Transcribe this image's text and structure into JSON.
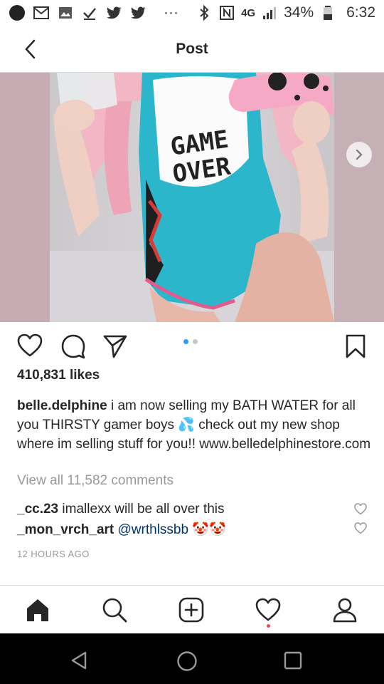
{
  "status_bar": {
    "battery": "34%",
    "time": "6:32",
    "network": "4G"
  },
  "header": {
    "title": "Post"
  },
  "post": {
    "image_alt": "Photo post, slide 1 of 2",
    "shirt_text": "GAME OVER",
    "carousel_count": 2,
    "carousel_active": 1
  },
  "likes": "410,831 likes",
  "caption": {
    "username": "belle.delphine",
    "text_before_emoji": "i am now selling my BATH WATER for all you THIRSTY gamer boys",
    "emoji": "💦",
    "text_after_emoji": "check out my new shop where im selling stuff for you!! www.belledelphinestore.com"
  },
  "view_comments": "View all 11,582 comments",
  "comments": [
    {
      "username": "_cc.23",
      "text": "imallexx will be all over this",
      "mention": "",
      "emoji": ""
    },
    {
      "username": "_mon_vrch_art",
      "text": "",
      "mention": "@wrthlssbb",
      "emoji": "🤡🤡"
    }
  ],
  "timestamp": "12 HOURS AGO",
  "colors": {
    "accent_blue": "#3897f0",
    "mention_blue": "#003569",
    "notification_red": "#ed4956",
    "muted_text": "#999999",
    "divider": "#dbdbdb"
  },
  "icons": {
    "back": "chevron-left-icon",
    "next": "chevron-right-icon",
    "like": "heart-icon",
    "comment": "comment-icon",
    "share": "paper-plane-icon",
    "save": "bookmark-icon",
    "home": "home-icon",
    "search": "search-icon",
    "new_post": "plus-square-icon",
    "activity": "heart-icon",
    "profile": "person-icon"
  }
}
